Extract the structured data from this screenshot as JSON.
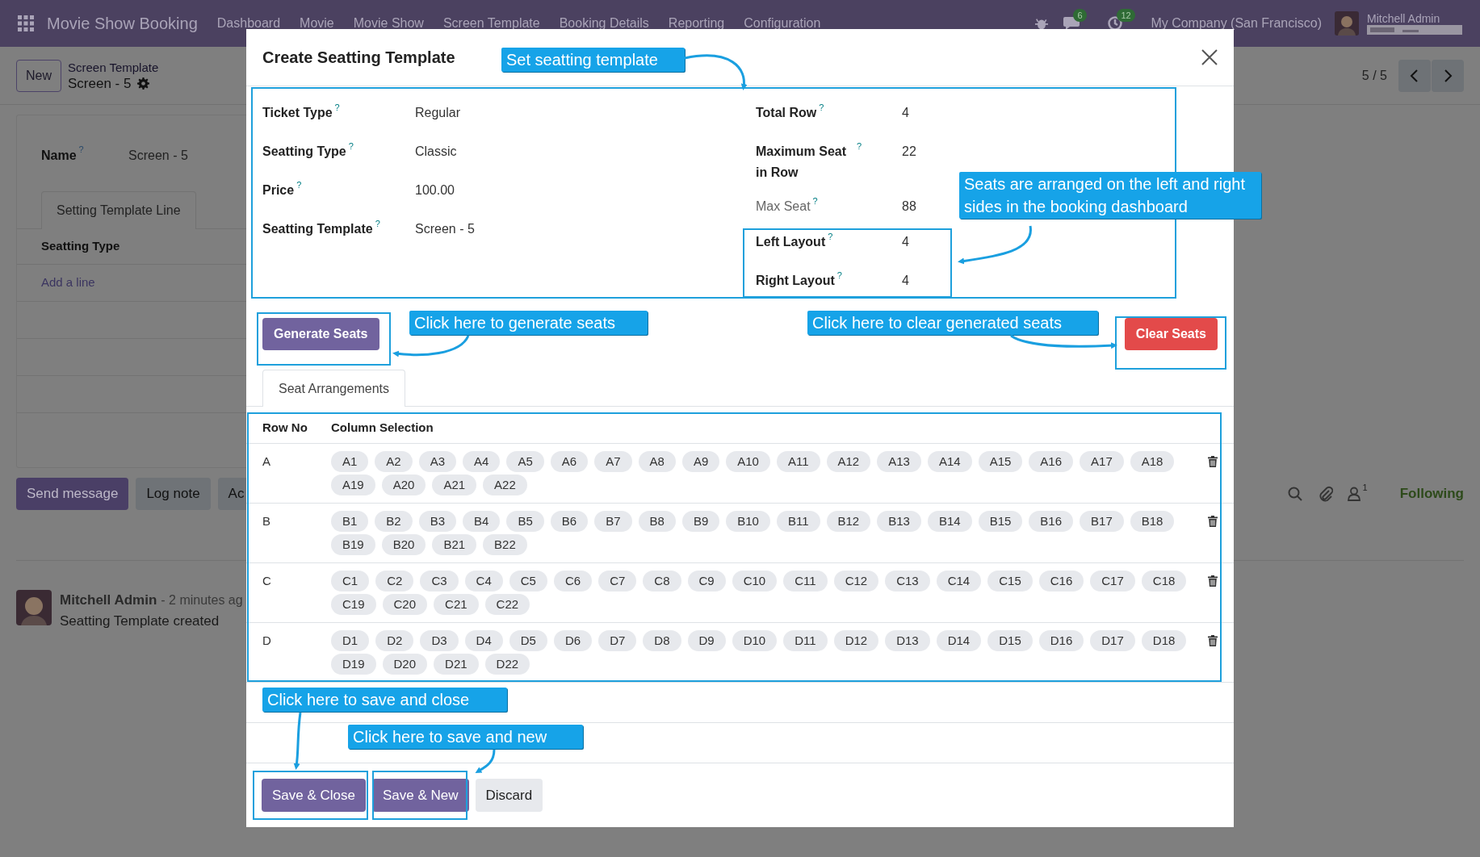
{
  "navbar": {
    "app_name": "Movie Show Booking",
    "menu": [
      "Dashboard",
      "Movie",
      "Movie Show",
      "Screen Template",
      "Booking Details",
      "Reporting",
      "Configuration"
    ],
    "chat_count": "6",
    "activity_count": "12",
    "company": "My Company (San Francisco)",
    "user": "Mitchell Admin"
  },
  "control_panel": {
    "new_button": "New",
    "breadcrumb": "Screen Template",
    "record": "Screen - 5",
    "pager": "5 / 5"
  },
  "form": {
    "fields": [
      {
        "label": "Name",
        "help": "?",
        "value": "Screen - 5"
      }
    ],
    "tabs": [
      {
        "label": "Setting Template Line",
        "selected": true
      }
    ],
    "columns": [
      "Seatting Type"
    ],
    "add_line": "Add a line"
  },
  "chatter": {
    "buttons": [
      {
        "label": "Send message",
        "kind": "primary"
      },
      {
        "label": "Log note",
        "kind": "secondary"
      },
      {
        "label": "Ac",
        "kind": "secondary"
      }
    ],
    "followers": "1",
    "follow_button": "Following",
    "messages": [
      {
        "author": "Mitchell Admin",
        "time": "- 2 minutes ag",
        "body": "Seatting Template created"
      }
    ]
  },
  "dialog": {
    "title": "Create Seatting Template",
    "left_fields": [
      {
        "label": "Ticket Type",
        "help": "?",
        "value": "Regular",
        "readonly": false
      },
      {
        "label": "Seatting Type",
        "help": "?",
        "value": "Classic",
        "readonly": false
      },
      {
        "label": "Price",
        "help": "?",
        "value": "100.00",
        "readonly": false
      },
      {
        "label": "Seatting Template",
        "help": "?",
        "value": "Screen - 5",
        "readonly": false
      }
    ],
    "right_fields": [
      {
        "label": "Total Row",
        "help": "?",
        "value": "4",
        "readonly": false
      },
      {
        "label": "Maximum Seat in Row",
        "help": "?",
        "value": "22",
        "readonly": false
      },
      {
        "label": "Max Seat",
        "help": "?",
        "value": "88",
        "readonly": true
      },
      {
        "label": "Left Layout",
        "help": "?",
        "value": "4",
        "readonly": false
      },
      {
        "label": "Right Layout",
        "help": "?",
        "value": "4",
        "readonly": false
      }
    ],
    "actions": [
      {
        "label": "Generate Seats",
        "kind": "primary"
      },
      {
        "label": "Clear Seats",
        "kind": "danger"
      }
    ],
    "tabs": [
      {
        "label": "Seat Arrangements",
        "selected": true
      }
    ],
    "columns": [
      "Row No",
      "Column Selection"
    ],
    "rows": [
      {
        "row": "A",
        "seats": [
          "A1",
          "A2",
          "A3",
          "A4",
          "A5",
          "A6",
          "A7",
          "A8",
          "A9",
          "A10",
          "A11",
          "A12",
          "A13",
          "A14",
          "A15",
          "A16",
          "A17",
          "A18",
          "A19",
          "A20",
          "A21",
          "A22"
        ]
      },
      {
        "row": "B",
        "seats": [
          "B1",
          "B2",
          "B3",
          "B4",
          "B5",
          "B6",
          "B7",
          "B8",
          "B9",
          "B10",
          "B11",
          "B12",
          "B13",
          "B14",
          "B15",
          "B16",
          "B17",
          "B18",
          "B19",
          "B20",
          "B21",
          "B22"
        ]
      },
      {
        "row": "C",
        "seats": [
          "C1",
          "C2",
          "C3",
          "C4",
          "C5",
          "C6",
          "C7",
          "C8",
          "C9",
          "C10",
          "C11",
          "C12",
          "C13",
          "C14",
          "C15",
          "C16",
          "C17",
          "C18",
          "C19",
          "C20",
          "C21",
          "C22"
        ]
      },
      {
        "row": "D",
        "seats": [
          "D1",
          "D2",
          "D3",
          "D4",
          "D5",
          "D6",
          "D7",
          "D8",
          "D9",
          "D10",
          "D11",
          "D12",
          "D13",
          "D14",
          "D15",
          "D16",
          "D17",
          "D18",
          "D19",
          "D20",
          "D21",
          "D22"
        ]
      }
    ],
    "footer_buttons": [
      {
        "label": "Save & Close",
        "kind": "primary"
      },
      {
        "label": "Save & New",
        "kind": "primary"
      },
      {
        "label": "Discard",
        "kind": "secondary"
      }
    ]
  },
  "annotations": [
    {
      "text": "Set seatting template"
    },
    {
      "text": "Seats are arranged on the left and right sides in the booking dashboard"
    },
    {
      "text": "Click here to generate seats"
    },
    {
      "text": "Click here to clear generated seats"
    },
    {
      "text": "Click here to save and close"
    },
    {
      "text": "Click here to save and new"
    }
  ]
}
